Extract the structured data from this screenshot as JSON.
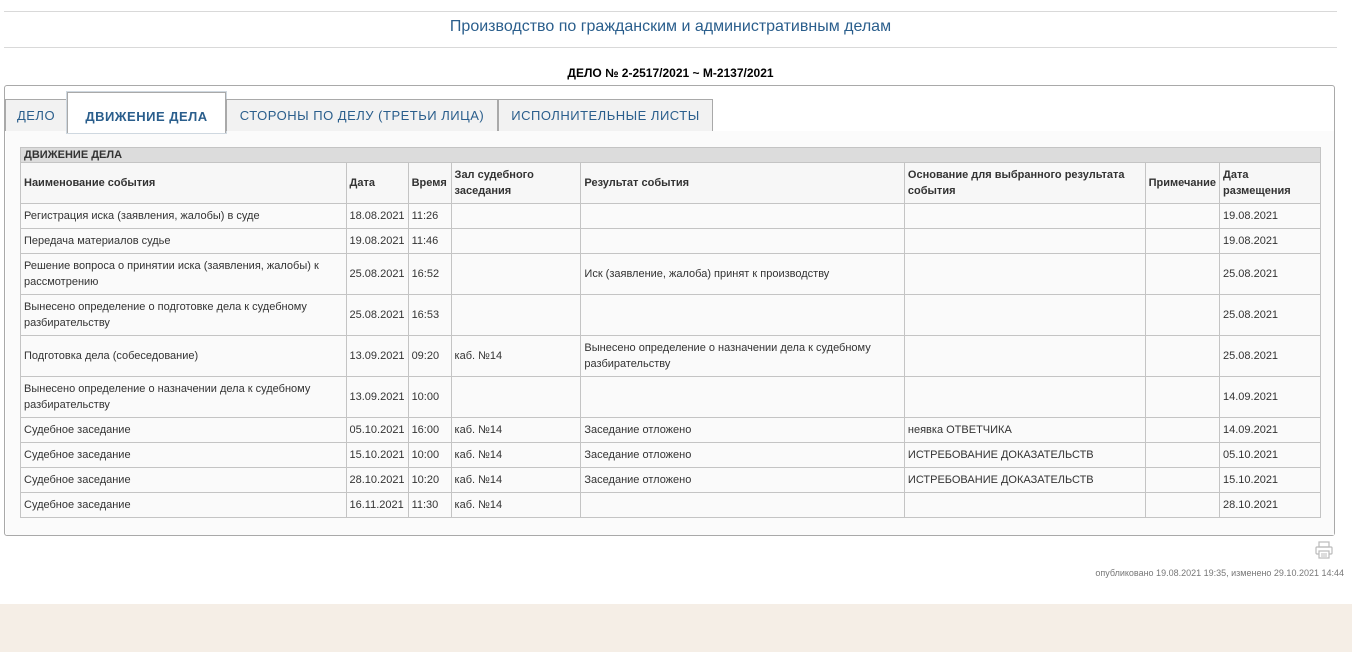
{
  "header": {
    "title": "Производство по гражданским и административным делам"
  },
  "case": {
    "number": "ДЕЛО № 2-2517/2021 ~ М-2137/2021"
  },
  "tabs": [
    {
      "label": "ДЕЛО"
    },
    {
      "label": "ДВИЖЕНИЕ ДЕЛА"
    },
    {
      "label": "СТОРОНЫ ПО ДЕЛУ (ТРЕТЬИ ЛИЦА)"
    },
    {
      "label": "ИСПОЛНИТЕЛЬНЫЕ ЛИСТЫ"
    }
  ],
  "table": {
    "caption": "ДВИЖЕНИЕ ДЕЛА",
    "columns": [
      "Наименование события",
      "Дата",
      "Время",
      "Зал судебного заседания",
      "Результат события",
      "Основание для выбранного результата события",
      "Примечание",
      "Дата размещения"
    ],
    "rows": [
      [
        "Регистрация иска (заявления, жалобы) в суде",
        "18.08.2021",
        "11:26",
        "",
        "",
        "",
        "",
        "19.08.2021"
      ],
      [
        "Передача материалов судье",
        "19.08.2021",
        "11:46",
        "",
        "",
        "",
        "",
        "19.08.2021"
      ],
      [
        "Решение вопроса о принятии иска (заявления, жалобы) к рассмотрению",
        "25.08.2021",
        "16:52",
        "",
        "Иск (заявление, жалоба) принят к производству",
        "",
        "",
        "25.08.2021"
      ],
      [
        "Вынесено определение о подготовке дела к судебному разбирательству",
        "25.08.2021",
        "16:53",
        "",
        "",
        "",
        "",
        "25.08.2021"
      ],
      [
        "Подготовка дела (собеседование)",
        "13.09.2021",
        "09:20",
        "каб. №14",
        "Вынесено определение о назначении дела к судебному разбирательству",
        "",
        "",
        "25.08.2021"
      ],
      [
        "Вынесено определение о назначении дела к судебному разбирательству",
        "13.09.2021",
        "10:00",
        "",
        "",
        "",
        "",
        "14.09.2021"
      ],
      [
        "Судебное заседание",
        "05.10.2021",
        "16:00",
        "каб. №14",
        "Заседание отложено",
        "неявка ОТВЕТЧИКА",
        "",
        "14.09.2021"
      ],
      [
        "Судебное заседание",
        "15.10.2021",
        "10:00",
        "каб. №14",
        "Заседание отложено",
        "ИСТРЕБОВАНИЕ ДОКАЗАТЕЛЬСТВ",
        "",
        "05.10.2021"
      ],
      [
        "Судебное заседание",
        "28.10.2021",
        "10:20",
        "каб. №14",
        "Заседание отложено",
        "ИСТРЕБОВАНИЕ ДОКАЗАТЕЛЬСТВ",
        "",
        "15.10.2021"
      ],
      [
        "Судебное заседание",
        "16.11.2021",
        "11:30",
        "каб. №14",
        "",
        "",
        "",
        "28.10.2021"
      ]
    ]
  },
  "footer": {
    "meta": "опубликовано 19.08.2021 19:35, изменено 29.10.2021 14:44"
  },
  "colors": {
    "accent": "#2a5e8c",
    "caption_bg": "#dcdcdc",
    "bottom_band": "#f5eee6"
  },
  "icons": {
    "print": "printer-icon"
  }
}
